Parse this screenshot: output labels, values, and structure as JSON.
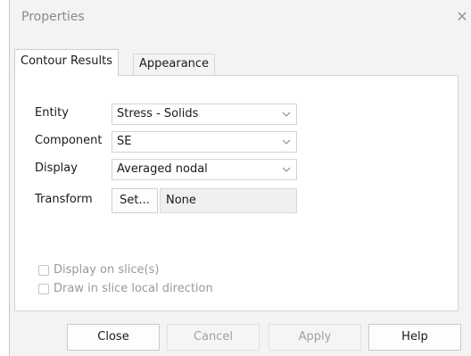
{
  "window": {
    "title": "Properties",
    "close_glyph": "✕"
  },
  "tabs": [
    {
      "label": "Contour Results",
      "active": true
    },
    {
      "label": "Appearance",
      "active": false
    }
  ],
  "form": {
    "entity": {
      "label": "Entity",
      "value": "Stress - Solids"
    },
    "component": {
      "label": "Component",
      "value": "SE"
    },
    "display": {
      "label": "Display",
      "value": "Averaged nodal"
    },
    "transform": {
      "label": "Transform",
      "button_label": "Set...",
      "value": "None"
    }
  },
  "options": [
    {
      "label": "Display on slice(s)",
      "checked": false,
      "enabled": false
    },
    {
      "label": "Draw in slice local direction",
      "checked": false,
      "enabled": false
    }
  ],
  "buttons": {
    "close": {
      "label": "Close",
      "enabled": true
    },
    "cancel": {
      "label": "Cancel",
      "enabled": false
    },
    "apply": {
      "label": "Apply",
      "enabled": false
    },
    "help": {
      "label": "Help",
      "enabled": true
    }
  },
  "icons": {
    "dropdown": "chevron-down-icon",
    "close": "close-icon"
  }
}
